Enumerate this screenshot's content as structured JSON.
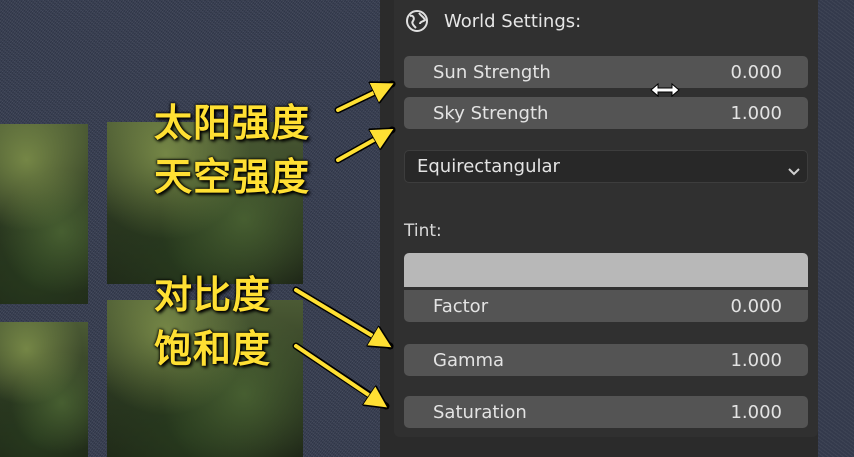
{
  "panel": {
    "title": "World Settings:",
    "title_icon": "world-icon",
    "sun_strength": {
      "label": "Sun Strength",
      "value": "0.000"
    },
    "sky_strength": {
      "label": "Sky Strength",
      "value": "1.000"
    },
    "projection": {
      "selected": "Equirectangular"
    },
    "tint_label": "Tint:",
    "tint_color": "#b8b8b8",
    "factor": {
      "label": "Factor",
      "value": "0.000"
    },
    "gamma": {
      "label": "Gamma",
      "value": "1.000"
    },
    "saturation": {
      "label": "Saturation",
      "value": "1.000"
    }
  },
  "annotations": {
    "sun": "太阳强度",
    "sky": "天空强度",
    "contrast": "对比度",
    "saturation": "饱和度",
    "color": "#ffe033"
  },
  "cursor": "horizontal-resize-icon"
}
